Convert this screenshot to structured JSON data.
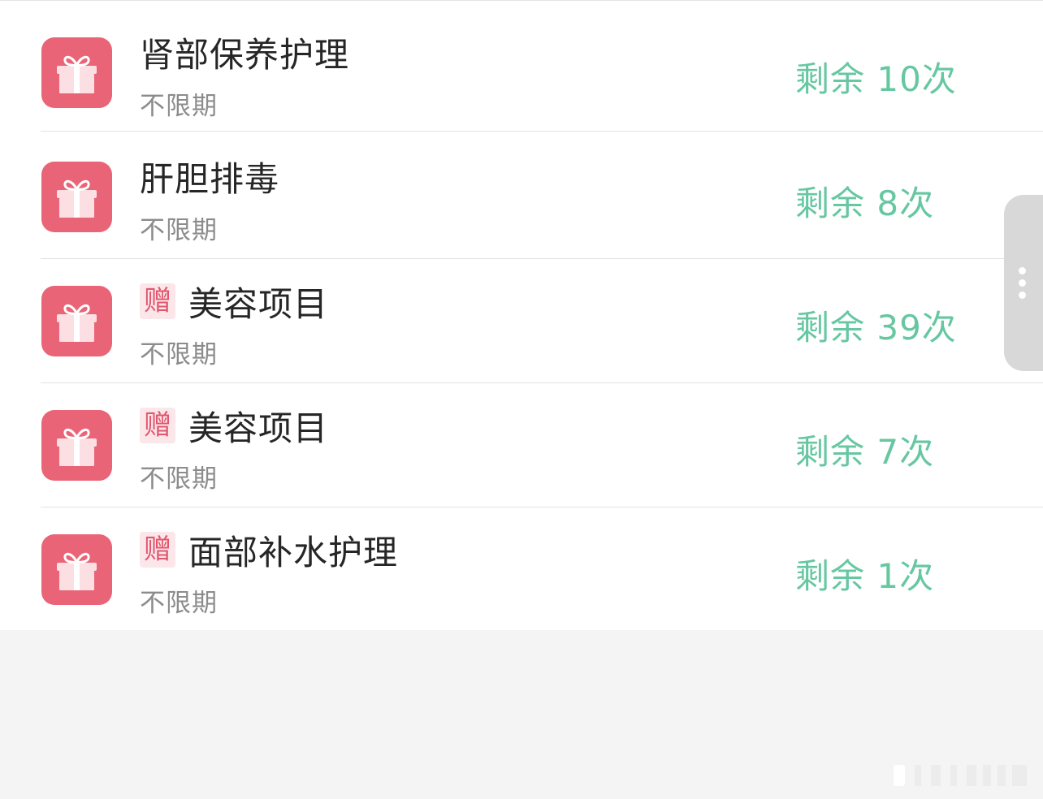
{
  "items": [
    {
      "title": "肾部保养护理",
      "gift_tag": "",
      "term": "不限期",
      "remaining": "剩余 10次",
      "icon": "gift-icon"
    },
    {
      "title": "肝胆排毒",
      "gift_tag": "",
      "term": "不限期",
      "remaining": "剩余 8次",
      "icon": "gift-icon"
    },
    {
      "title": "美容项目",
      "gift_tag": "赠",
      "term": "不限期",
      "remaining": "剩余 39次",
      "icon": "gift-icon"
    },
    {
      "title": "美容项目",
      "gift_tag": "赠",
      "term": "不限期",
      "remaining": "剩余 7次",
      "icon": "gift-icon"
    },
    {
      "title": "面部补水护理",
      "gift_tag": "赠",
      "term": "不限期",
      "remaining": "剩余 1次",
      "icon": "gift-icon"
    }
  ],
  "side_handle": {
    "icon": "more-vertical-icon"
  },
  "colors": {
    "icon_bg": "#ea6478",
    "remaining_text": "#66c7a1",
    "gift_tag_text": "#e2566d",
    "gift_tag_bg": "#fbe6ea",
    "page_bg": "#f4f4f4"
  }
}
